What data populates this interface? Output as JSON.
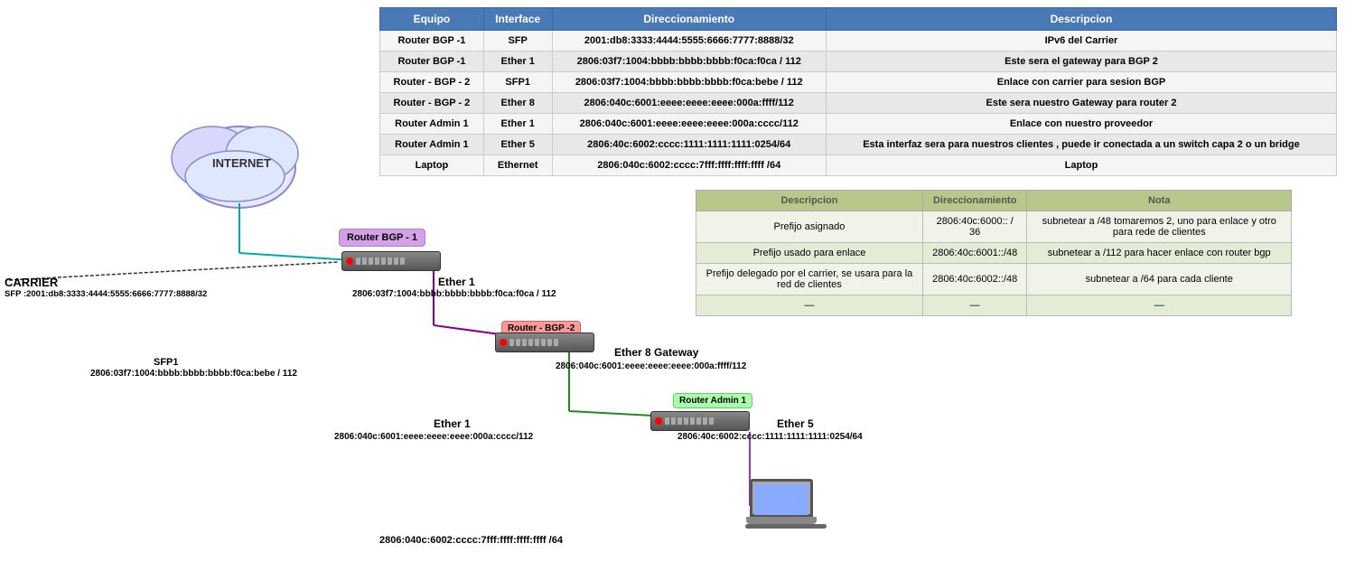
{
  "table": {
    "headers": [
      "Equipo",
      "Interface",
      "Direccionamiento",
      "Descripcion"
    ],
    "rows": [
      {
        "equipo": "Router BGP -1",
        "interface": "SFP",
        "direccionamiento": "2001:db8:3333:4444:5555:6666:7777:8888/32",
        "descripcion": "IPv6 del Carrier"
      },
      {
        "equipo": "Router BGP -1",
        "interface": "Ether 1",
        "direccionamiento": "2806:03f7:1004:bbbb:bbbb:bbbb:f0ca:f0ca / 112",
        "descripcion": "Este sera el gateway para BGP 2"
      },
      {
        "equipo": "Router - BGP - 2",
        "interface": "SFP1",
        "direccionamiento": "2806:03f7:1004:bbbb:bbbb:bbbb:f0ca:bebe / 112",
        "descripcion": "Enlace con carrier para sesion BGP"
      },
      {
        "equipo": "Router - BGP - 2",
        "interface": "Ether 8",
        "direccionamiento": "2806:040c:6001:eeee:eeee:eeee:000a:ffff/112",
        "descripcion": "Este sera nuestro Gateway para router 2"
      },
      {
        "equipo": "Router Admin 1",
        "interface": "Ether 1",
        "direccionamiento": "2806:040c:6001:eeee:eeee:eeee:000a:cccc/112",
        "descripcion": "Enlace con nuestro proveedor"
      },
      {
        "equipo": "Router Admin 1",
        "interface": "Ether 5",
        "direccionamiento": "2806:40c:6002:cccc:1111:1111:1111:0254/64",
        "descripcion": "Esta interfaz sera para nuestros clientes , puede ir conectada a un switch capa 2 o un bridge"
      },
      {
        "equipo": "Laptop",
        "interface": "Ethernet",
        "direccionamiento": "2806:040c:6002:cccc:7fff:ffff:ffff:ffff /64",
        "descripcion": "Laptop"
      }
    ]
  },
  "lower_table": {
    "headers": [
      "Descripcion",
      "Direccionamiento",
      "Nota"
    ],
    "rows": [
      {
        "descripcion": "Prefijo asignado",
        "direccionamiento": "2806:40c:6000:: / 36",
        "nota": "subnetear a /48  tomaremos 2, uno para enlace y otro para rede de clientes"
      },
      {
        "descripcion": "Prefijo usado para enlace",
        "direccionamiento": "2806:40c:6001::/48",
        "nota": "subnetear a /112 para hacer enlace con router bgp"
      },
      {
        "descripcion": "Prefijo delegado por el carrier, se usara para la red de clientes",
        "direccionamiento": "2806:40c:6002::/48",
        "nota": "subnetear a /64 para cada cliente"
      },
      {
        "descripcion": "—",
        "direccionamiento": "—",
        "nota": "—"
      }
    ]
  },
  "diagram": {
    "internet_label": "INTERNET",
    "carrier_label": "CARRIER",
    "carrier_sfp": "SFP :2001:db8:3333:4444:5555:6666:7777:8888/32",
    "router_bgp1": {
      "label": "Router BGP -\n1",
      "ether1_label": "Ether 1",
      "ether1_addr": "2806:03f7:1004:bbbb:bbbb:bbbb:f0ca:f0ca / 112"
    },
    "router_bgp2": {
      "label": "Router - BGP -2",
      "sfp1_label": "SFP1",
      "sfp1_addr": "2806:03f7:1004:bbbb:bbbb:bbbb:f0ca:bebe / 112",
      "ether8_label": "Ether 8 Gateway",
      "ether8_addr": "2806:040c:6001:eeee:eeee:eeee:000a:ffff/112"
    },
    "router_admin1": {
      "label": "Router Admin 1",
      "ether1_label": "Ether 1",
      "ether1_addr": "2806:040c:6001:eeee:eeee:eeee:000a:cccc/112",
      "ether5_label": "Ether 5",
      "ether5_addr": "2806:40c:6002:cccc:1111:1111:1111:0254/64"
    },
    "laptop_addr": "2806:040c:6002:cccc:7fff:ffff:ffff:ffff /64"
  }
}
